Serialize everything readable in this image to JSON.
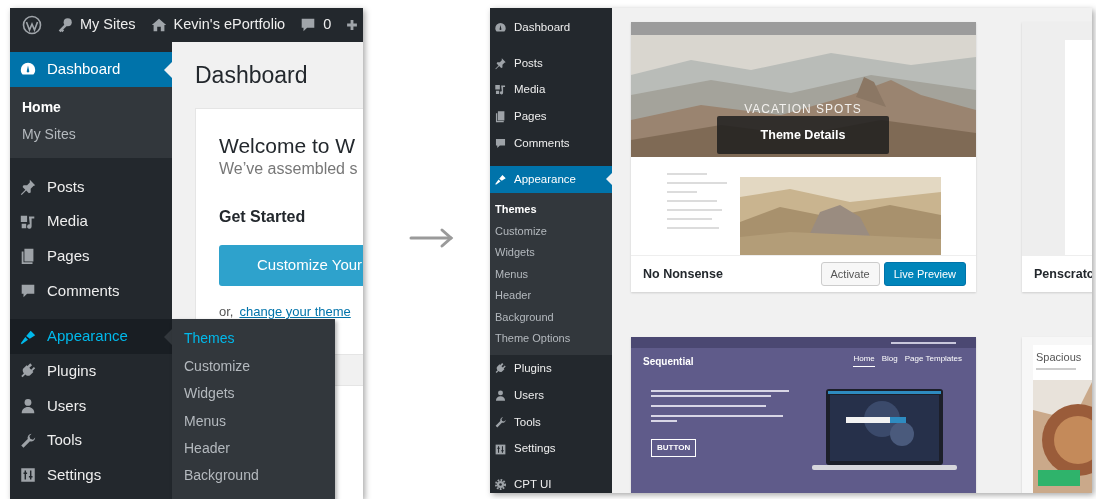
{
  "left_screen": {
    "admin_bar": [
      {
        "kind": "logo"
      },
      {
        "kind": "key",
        "label": "My Sites"
      },
      {
        "kind": "home",
        "label": "Kevin's ePortfolio"
      },
      {
        "kind": "comment",
        "label": "0"
      },
      {
        "kind": "plus"
      }
    ],
    "menu_groups": [
      [
        {
          "kind": "dashboard",
          "label": "Dashboard",
          "selected": true,
          "hovered": false,
          "submenu": [
            {
              "label": "Home",
              "selected": true
            },
            {
              "label": "My Sites",
              "selected": false
            }
          ]
        }
      ],
      [
        {
          "kind": "pin",
          "label": "Posts",
          "selected": false,
          "hovered": false
        },
        {
          "kind": "media",
          "label": "Media",
          "selected": false,
          "hovered": false
        },
        {
          "kind": "pages",
          "label": "Pages",
          "selected": false,
          "hovered": false
        },
        {
          "kind": "comment",
          "label": "Comments",
          "selected": false,
          "hovered": false
        }
      ],
      [
        {
          "kind": "brush",
          "label": "Appearance",
          "selected": false,
          "hovered": true,
          "submenu": [
            {
              "label": "Themes",
              "selected": true
            },
            {
              "label": "Customize",
              "selected": false
            },
            {
              "label": "Widgets",
              "selected": false
            },
            {
              "label": "Menus",
              "selected": false
            },
            {
              "label": "Header",
              "selected": false
            },
            {
              "label": "Background",
              "selected": false
            }
          ]
        },
        {
          "kind": "plug",
          "label": "Plugins",
          "selected": false,
          "hovered": false
        },
        {
          "kind": "user",
          "label": "Users",
          "selected": false,
          "hovered": false
        },
        {
          "kind": "wrench",
          "label": "Tools",
          "selected": false,
          "hovered": false
        },
        {
          "kind": "settings",
          "label": "Settings",
          "selected": false,
          "hovered": false
        }
      ]
    ],
    "page_title": "Dashboard",
    "welcome": {
      "title": "Welcome to W",
      "subtitle": "We’ve assembled s",
      "heading": "Get Started",
      "button": "Customize Your",
      "or_text": "or,",
      "link": "change your theme"
    }
  },
  "right_screen": {
    "menu_groups": [
      [
        {
          "kind": "dashboard",
          "label": "Dashboard",
          "selected": false,
          "hovered": false
        }
      ],
      [
        {
          "kind": "pin",
          "label": "Posts",
          "selected": false,
          "hovered": false
        },
        {
          "kind": "media",
          "label": "Media",
          "selected": false,
          "hovered": false
        },
        {
          "kind": "pages",
          "label": "Pages",
          "selected": false,
          "hovered": false
        },
        {
          "kind": "comment",
          "label": "Comments",
          "selected": false,
          "hovered": false
        }
      ],
      [
        {
          "kind": "brush",
          "label": "Appearance",
          "selected": true,
          "hovered": false,
          "submenu": [
            {
              "label": "Themes",
              "selected": true
            },
            {
              "label": "Customize",
              "selected": false
            },
            {
              "label": "Widgets",
              "selected": false
            },
            {
              "label": "Menus",
              "selected": false
            },
            {
              "label": "Header",
              "selected": false
            },
            {
              "label": "Background",
              "selected": false
            },
            {
              "label": "Theme Options",
              "selected": false
            }
          ]
        },
        {
          "kind": "plug",
          "label": "Plugins",
          "selected": false,
          "hovered": false
        },
        {
          "kind": "user",
          "label": "Users",
          "selected": false,
          "hovered": false
        },
        {
          "kind": "wrench",
          "label": "Tools",
          "selected": false,
          "hovered": false
        },
        {
          "kind": "settings",
          "label": "Settings",
          "selected": false,
          "hovered": false
        }
      ],
      [
        {
          "kind": "gear",
          "label": "CPT UI",
          "selected": false,
          "hovered": false
        }
      ]
    ],
    "themes": [
      {
        "name": "No Nonsense",
        "hero_text": "VACATION SPOTS",
        "overlay": "Theme Details",
        "buttons": [
          {
            "label": "Activate",
            "kind": "secondary"
          },
          {
            "label": "Live Preview",
            "kind": "primary"
          }
        ]
      },
      {
        "kind": "blank",
        "name": "Penscratc"
      },
      {
        "kind": "purple",
        "site_title": "Sequential",
        "nav": [
          {
            "label": "Home",
            "selected": true
          },
          {
            "label": "Blog",
            "selected": false
          },
          {
            "label": "Page Templates",
            "selected": false
          }
        ],
        "button": "BUTTON"
      },
      {
        "kind": "side_photo",
        "site_title": "Spacious"
      }
    ]
  }
}
